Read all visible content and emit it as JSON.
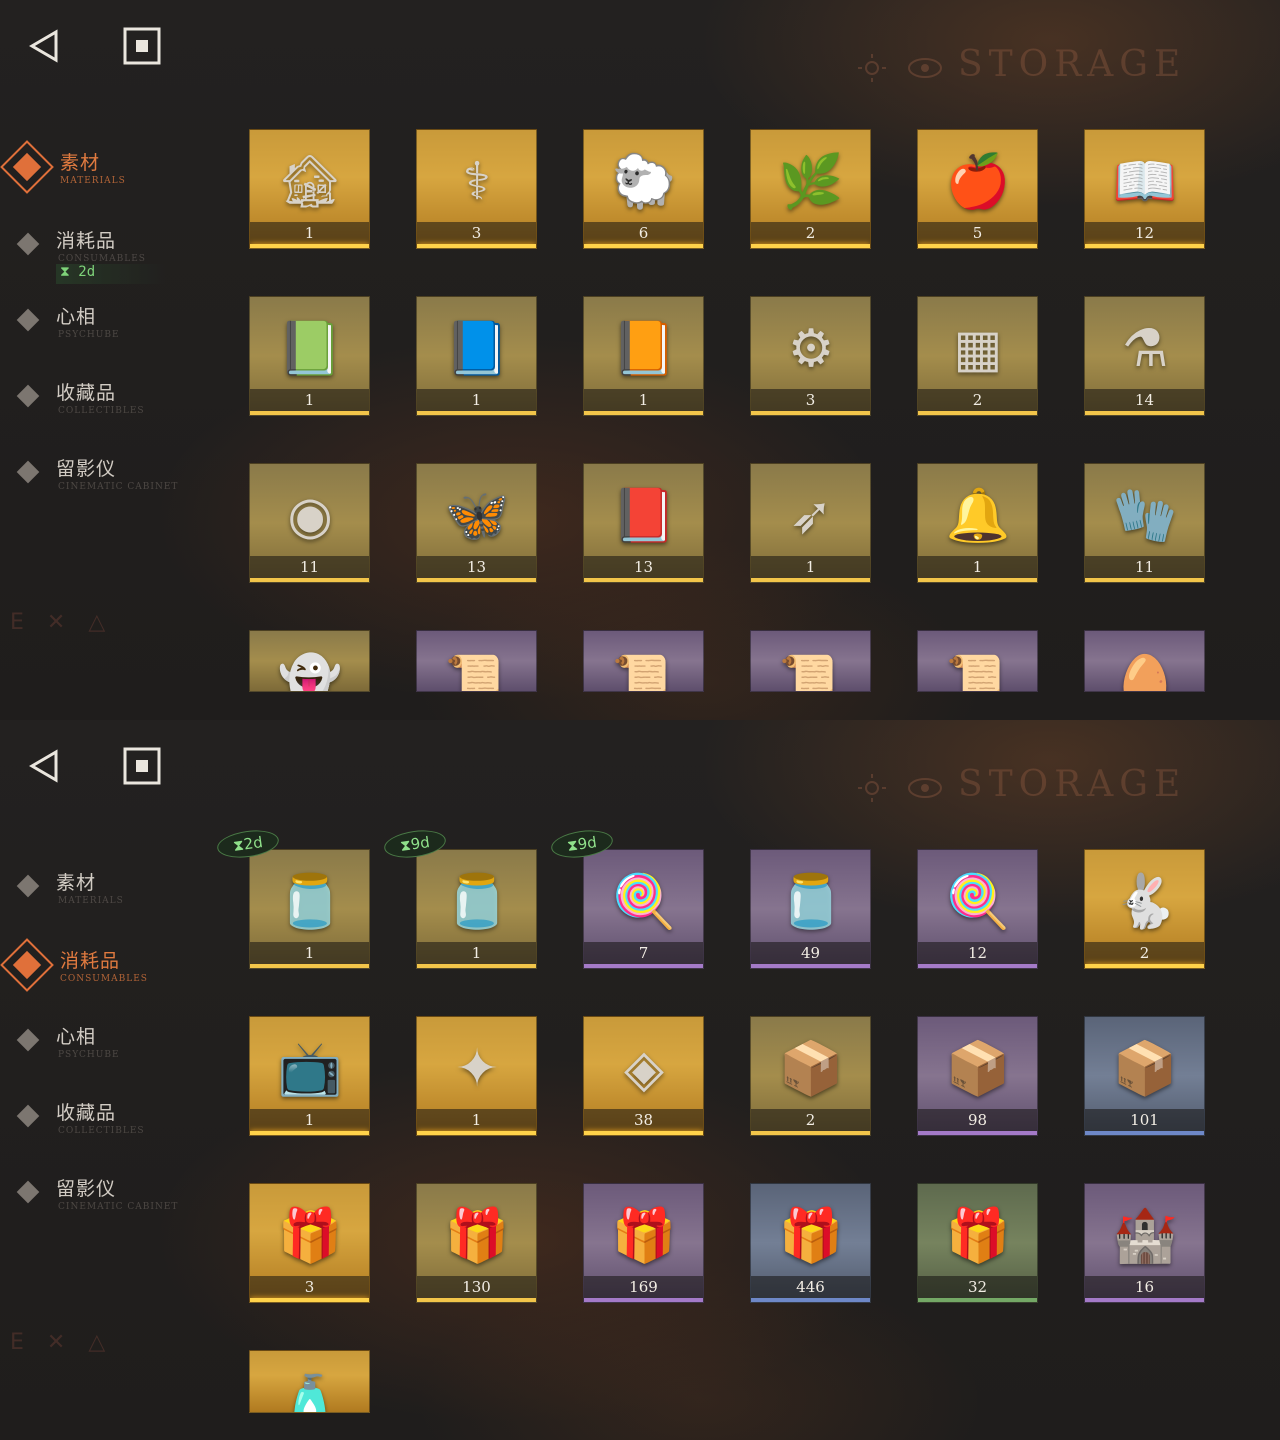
{
  "screen_title": "STORAGE",
  "side_deco": "E ✕ △",
  "icons": {
    "back": "back-triangle-icon",
    "home": "stop-square-icon"
  },
  "colors": {
    "accent": "#e07a3f",
    "timer_green": "#7fd37a",
    "gold_rarity": "#ffd24a",
    "purple_rarity": "#a47ac8",
    "blue_rarity": "#6e88c8",
    "green_rarity": "#74a866"
  },
  "top": {
    "nav": [
      {
        "label": "素材",
        "sub": "MATERIALS",
        "active": true
      },
      {
        "label": "消耗品",
        "sub": "CONSUMABLES",
        "active": false
      },
      {
        "label": "心相",
        "sub": "PSYCHUBE",
        "active": false
      },
      {
        "label": "收藏品",
        "sub": "COLLECTIBLES",
        "active": false
      },
      {
        "label": "留影仪",
        "sub": "CINEMATIC CABINET",
        "active": false
      }
    ],
    "consumables_timer": "2d",
    "items": [
      {
        "name": "hut",
        "glyph": "🏚",
        "count": "1",
        "tier": "gold"
      },
      {
        "name": "caduceus",
        "glyph": "⚕",
        "count": "3",
        "tier": "gold"
      },
      {
        "name": "golden-sheep",
        "glyph": "🐑",
        "count": "6",
        "tier": "gold"
      },
      {
        "name": "laurel-wreath",
        "glyph": "🌿",
        "count": "2",
        "tier": "gold"
      },
      {
        "name": "apple-serpent",
        "glyph": "🍎",
        "count": "5",
        "tier": "gold"
      },
      {
        "name": "red-book",
        "glyph": "📖",
        "count": "12",
        "tier": "gold"
      },
      {
        "name": "green-book",
        "glyph": "📗",
        "count": "1",
        "tier": "gold2"
      },
      {
        "name": "blue-book",
        "glyph": "📘",
        "count": "1",
        "tier": "gold2"
      },
      {
        "name": "gold-book",
        "glyph": "📙",
        "count": "1",
        "tier": "gold2"
      },
      {
        "name": "clockwork",
        "glyph": "⚙",
        "count": "3",
        "tier": "gold2"
      },
      {
        "name": "green-tablet",
        "glyph": "▦",
        "count": "2",
        "tier": "gold2"
      },
      {
        "name": "potion-bottle",
        "glyph": "⚗",
        "count": "14",
        "tier": "gold2"
      },
      {
        "name": "brass-orb",
        "glyph": "◉",
        "count": "11",
        "tier": "gold2"
      },
      {
        "name": "firefly",
        "glyph": "🦋",
        "count": "13",
        "tier": "gold2"
      },
      {
        "name": "dark-tome",
        "glyph": "📕",
        "count": "13",
        "tier": "gold2"
      },
      {
        "name": "bullets",
        "glyph": "➶",
        "count": "1",
        "tier": "gold2"
      },
      {
        "name": "bell-jar",
        "glyph": "🔔",
        "count": "1",
        "tier": "gold2"
      },
      {
        "name": "glove-box",
        "glyph": "🧤",
        "count": "11",
        "tier": "gold2"
      },
      {
        "name": "ghost",
        "glyph": "👻",
        "count": "",
        "tier": "gold2"
      },
      {
        "name": "red-scroll",
        "glyph": "📜",
        "count": "",
        "tier": "purple"
      },
      {
        "name": "green-scroll",
        "glyph": "📜",
        "count": "",
        "tier": "purple"
      },
      {
        "name": "blue-scroll",
        "glyph": "📜",
        "count": "",
        "tier": "purple"
      },
      {
        "name": "gold-scroll",
        "glyph": "📜",
        "count": "",
        "tier": "purple"
      },
      {
        "name": "jeweled-egg",
        "glyph": "🥚",
        "count": "",
        "tier": "purple"
      }
    ]
  },
  "bottom": {
    "nav": [
      {
        "label": "素材",
        "sub": "MATERIALS",
        "active": false
      },
      {
        "label": "消耗品",
        "sub": "CONSUMABLES",
        "active": true
      },
      {
        "label": "心相",
        "sub": "PSYCHUBE",
        "active": false
      },
      {
        "label": "收藏品",
        "sub": "COLLECTIBLES",
        "active": false
      },
      {
        "label": "留影仪",
        "sub": "CINEMATIC CABINET",
        "active": false
      }
    ],
    "items": [
      {
        "name": "candy-jar",
        "glyph": "🫙",
        "count": "1",
        "tier": "gold2",
        "timer": "2d"
      },
      {
        "name": "candy-jar",
        "glyph": "🫙",
        "count": "1",
        "tier": "gold2",
        "timer": "9d"
      },
      {
        "name": "lollipops",
        "glyph": "🍭",
        "count": "7",
        "tier": "purple",
        "timer": "9d"
      },
      {
        "name": "candy-jar",
        "glyph": "🫙",
        "count": "49",
        "tier": "purple",
        "timer": ""
      },
      {
        "name": "lollipops",
        "glyph": "🍭",
        "count": "12",
        "tier": "purple",
        "timer": ""
      },
      {
        "name": "rabbit-box",
        "glyph": "🐇",
        "count": "2",
        "tier": "gold",
        "timer": ""
      },
      {
        "name": "radio-tv",
        "glyph": "📺",
        "count": "1",
        "tier": "gold",
        "timer": ""
      },
      {
        "name": "crystal-feather",
        "glyph": "✦",
        "count": "1",
        "tier": "gold",
        "timer": ""
      },
      {
        "name": "rune-chest",
        "glyph": "◈",
        "count": "38",
        "tier": "gold",
        "timer": ""
      },
      {
        "name": "crate",
        "glyph": "📦",
        "count": "2",
        "tier": "gold2",
        "timer": ""
      },
      {
        "name": "crate",
        "glyph": "📦",
        "count": "98",
        "tier": "purple",
        "timer": ""
      },
      {
        "name": "crate",
        "glyph": "📦",
        "count": "101",
        "tier": "blue",
        "timer": ""
      },
      {
        "name": "parcel",
        "glyph": "🎁",
        "count": "3",
        "tier": "gold",
        "timer": ""
      },
      {
        "name": "parcel",
        "glyph": "🎁",
        "count": "130",
        "tier": "gold2",
        "timer": ""
      },
      {
        "name": "parcel",
        "glyph": "🎁",
        "count": "169",
        "tier": "purple",
        "timer": ""
      },
      {
        "name": "parcel",
        "glyph": "🎁",
        "count": "446",
        "tier": "blue",
        "timer": ""
      },
      {
        "name": "parcel",
        "glyph": "🎁",
        "count": "32",
        "tier": "green",
        "timer": ""
      },
      {
        "name": "castle",
        "glyph": "🏰",
        "count": "16",
        "tier": "purple",
        "timer": ""
      },
      {
        "name": "medicine-bottle",
        "glyph": "🧴",
        "count": "",
        "tier": "gold",
        "timer": ""
      }
    ]
  }
}
